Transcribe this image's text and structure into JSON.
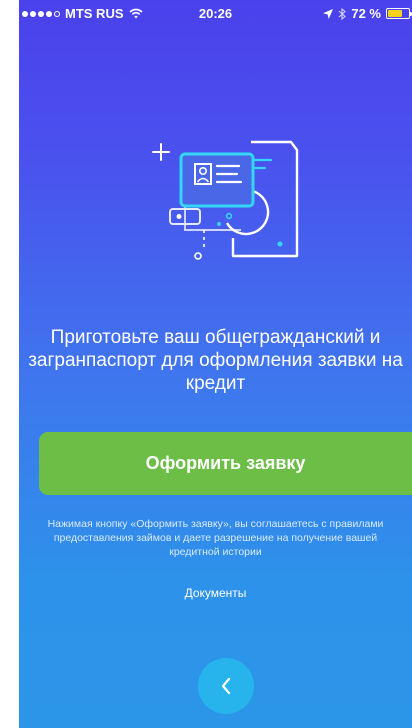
{
  "status_bar": {
    "carrier": "MTS RUS",
    "time": "20:26",
    "battery": "72 %",
    "battery_level": 0.72
  },
  "main": {
    "heading": "Приготовьте ваш общегражданский и загранпаспорт для оформления заявки на кредит",
    "submit_label": "Оформить заявку",
    "disclaimer": "Нажимая кнопку «Оформить заявку», вы соглашаетесь с правилами предоставления займов и даете разрешение на получение вашей кредитной истории",
    "documents_link": "Документы"
  },
  "icons": {
    "illustration": "passport-document-icon",
    "back": "chevron-left-icon",
    "wifi": "wifi-icon",
    "location": "location-arrow-icon",
    "bluetooth": "bluetooth-icon",
    "battery": "battery-icon"
  },
  "colors": {
    "background_top": "#4a41ec",
    "background_bottom": "#2b96e8",
    "button": "#6cbe47",
    "back_button": "#27b4ec",
    "accent": "#33d6f4",
    "battery": "#f2d21b"
  }
}
